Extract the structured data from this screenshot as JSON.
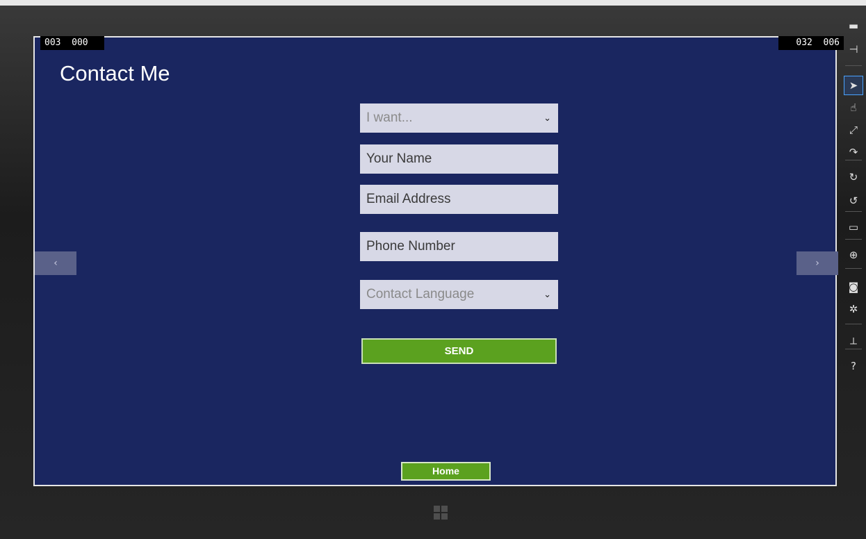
{
  "screen": {
    "counter_left": "003  000",
    "counter_right": "032  006",
    "title": "Contact Me"
  },
  "form": {
    "want_select": {
      "value": "I want...",
      "is_placeholder": true
    },
    "name_field": {
      "placeholder": "Your Name"
    },
    "email_field": {
      "placeholder": "Email Address"
    },
    "phone_field": {
      "placeholder": "Phone Number"
    },
    "language_select": {
      "value": "Contact Language",
      "is_placeholder": true
    },
    "send_label": "SEND"
  },
  "footer": {
    "home_label": "Home"
  },
  "navigation": {
    "prev_glyph": "‹",
    "next_glyph": "›"
  },
  "toolbar": {
    "items": [
      {
        "name": "minimize-icon",
        "glyph": "▬"
      },
      {
        "name": "pin-icon",
        "glyph": "⊣"
      },
      {
        "name": "mouse-mode-icon",
        "glyph": "➤",
        "active": true
      },
      {
        "name": "touch-mode-icon",
        "glyph": "☝"
      },
      {
        "name": "pinch-zoom-icon",
        "glyph": "⤢"
      },
      {
        "name": "rotate-gesture-icon",
        "glyph": "↷"
      },
      {
        "name": "rotate-clockwise-icon",
        "glyph": "↻"
      },
      {
        "name": "rotate-counterclockwise-icon",
        "glyph": "↺"
      },
      {
        "name": "resolution-icon",
        "glyph": "▭"
      },
      {
        "name": "location-icon",
        "glyph": "⊕"
      },
      {
        "name": "screenshot-icon",
        "glyph": "◙"
      },
      {
        "name": "settings-icon",
        "glyph": "✲"
      },
      {
        "name": "network-icon",
        "glyph": "⟂"
      },
      {
        "name": "help-icon",
        "glyph": "?"
      }
    ]
  },
  "colors": {
    "screen_background": "#1a2660",
    "field_background": "#d7d8e6",
    "button_green": "#5ba11f"
  }
}
